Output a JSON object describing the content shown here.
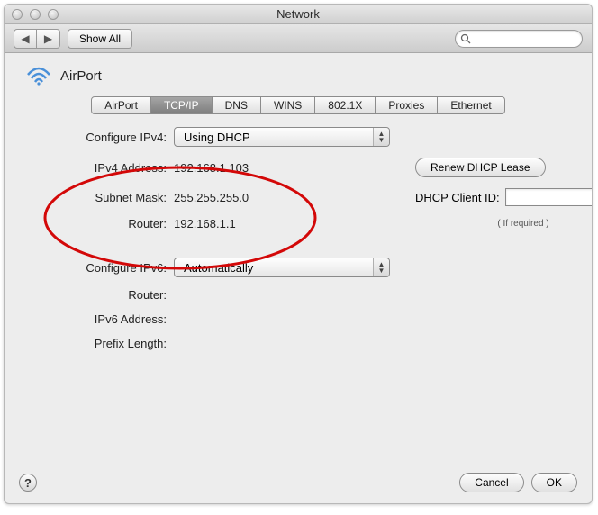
{
  "window": {
    "title": "Network"
  },
  "toolbar": {
    "show_all": "Show All",
    "search_placeholder": ""
  },
  "panel": {
    "interface_name": "AirPort"
  },
  "tabs": [
    "AirPort",
    "TCP/IP",
    "DNS",
    "WINS",
    "802.1X",
    "Proxies",
    "Ethernet"
  ],
  "tab_selected_index": 1,
  "labels": {
    "configure_ipv4": "Configure IPv4:",
    "ipv4_address": "IPv4 Address:",
    "subnet_mask": "Subnet Mask:",
    "router": "Router:",
    "configure_ipv6": "Configure IPv6:",
    "ipv6_router": "Router:",
    "ipv6_address": "IPv6 Address:",
    "prefix_length": "Prefix Length:",
    "dhcp_client_id": "DHCP Client ID:",
    "if_required": "( If required )"
  },
  "values": {
    "configure_ipv4": "Using DHCP",
    "ipv4_address": "192.168.1.103",
    "subnet_mask": "255.255.255.0",
    "router": "192.168.1.1",
    "configure_ipv6": "Automatically",
    "ipv6_router": "",
    "ipv6_address": "",
    "prefix_length": "",
    "dhcp_client_id": ""
  },
  "buttons": {
    "renew_dhcp": "Renew DHCP Lease",
    "cancel": "Cancel",
    "ok": "OK"
  }
}
